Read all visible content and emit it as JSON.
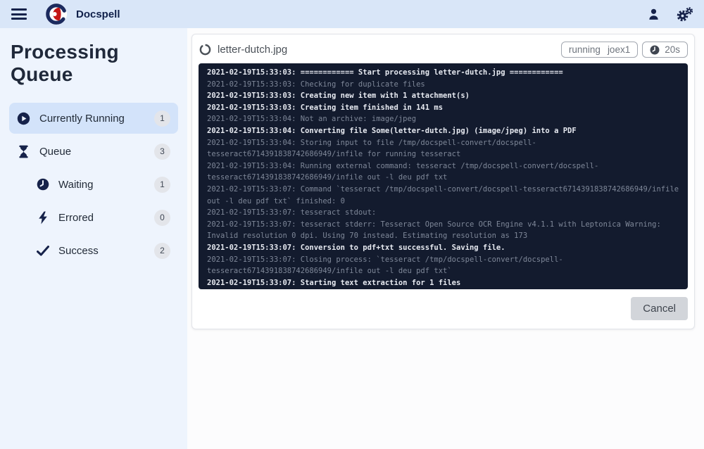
{
  "topbar": {
    "title": "Docspell"
  },
  "sidebar": {
    "title": "Processing Queue",
    "items": [
      {
        "label": "Currently Running",
        "count": "1",
        "icon": "play-circle-icon",
        "active": true,
        "indent": 0
      },
      {
        "label": "Queue",
        "count": "3",
        "icon": "hourglass-icon",
        "active": false,
        "indent": 0
      },
      {
        "label": "Waiting",
        "count": "1",
        "icon": "clock-icon",
        "active": false,
        "indent": 1
      },
      {
        "label": "Errored",
        "count": "0",
        "icon": "bolt-icon",
        "active": false,
        "indent": 1
      },
      {
        "label": "Success",
        "count": "2",
        "icon": "check-icon",
        "active": false,
        "indent": 1
      }
    ]
  },
  "job": {
    "filename": "letter-dutch.jpg",
    "state": "running",
    "worker": "joex1",
    "runtime": "20s",
    "cancel_label": "Cancel"
  },
  "log": {
    "entries": [
      {
        "emphasis": true,
        "text": "2021-02-19T15:33:03: ============ Start processing letter-dutch.jpg ============"
      },
      {
        "emphasis": false,
        "text": "2021-02-19T15:33:03: Checking for duplicate files"
      },
      {
        "emphasis": true,
        "text": "2021-02-19T15:33:03: Creating new item with 1 attachment(s)"
      },
      {
        "emphasis": true,
        "text": "2021-02-19T15:33:03: Creating item finished in 141 ms"
      },
      {
        "emphasis": false,
        "text": "2021-02-19T15:33:04: Not an archive: image/jpeg"
      },
      {
        "emphasis": true,
        "text": "2021-02-19T15:33:04: Converting file Some(letter-dutch.jpg) (image/jpeg) into a PDF"
      },
      {
        "emphasis": false,
        "text": "2021-02-19T15:33:04: Storing input to file /tmp/docspell-convert/docspell-tesseract6714391838742686949/infile for running tesseract"
      },
      {
        "emphasis": false,
        "text": "2021-02-19T15:33:04: Running external command: tesseract /tmp/docspell-convert/docspell-tesseract6714391838742686949/infile out -l deu pdf txt"
      },
      {
        "emphasis": false,
        "text": "2021-02-19T15:33:07: Command `tesseract /tmp/docspell-convert/docspell-tesseract6714391838742686949/infile out -l deu pdf txt` finished: 0"
      },
      {
        "emphasis": false,
        "text": "2021-02-19T15:33:07: tesseract stdout:"
      },
      {
        "emphasis": false,
        "text": "2021-02-19T15:33:07: tesseract stderr: Tesseract Open Source OCR Engine v4.1.1 with Leptonica Warning: Invalid resolution 0 dpi. Using 70 instead. Estimating resolution as 173"
      },
      {
        "emphasis": true,
        "text": "2021-02-19T15:33:07: Conversion to pdf+txt successful. Saving file."
      },
      {
        "emphasis": false,
        "text": "2021-02-19T15:33:07: Closing process: `tesseract /tmp/docspell-convert/docspell-tesseract6714391838742686949/infile out -l deu pdf txt`"
      },
      {
        "emphasis": true,
        "text": "2021-02-19T15:33:07: Starting text extraction for 1 files"
      }
    ]
  },
  "colors": {
    "topbar_bg": "#d9e6f8",
    "sidebar_bg": "#eef4fd",
    "active_item_bg": "#d3e3fa",
    "navy": "#16224a",
    "brand_red": "#c41616",
    "log_bg": "#131b2e",
    "log_bright": "#e7eaf1",
    "log_dim": "#7e8798"
  }
}
